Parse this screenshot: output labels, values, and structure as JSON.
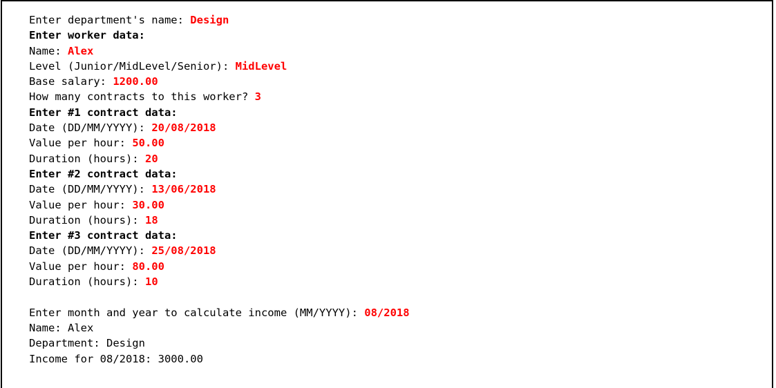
{
  "colors": {
    "input_text": "#ff0000",
    "output_text": "#000000",
    "background": "#ffffff",
    "border": "#000000"
  },
  "lines": {
    "dept_prompt": "Enter department's name: ",
    "dept_value": "Design",
    "worker_header": "Enter worker data:",
    "name_prompt": "Name: ",
    "name_value": "Alex",
    "level_prompt": "Level (Junior/MidLevel/Senior): ",
    "level_value": "MidLevel",
    "salary_prompt": "Base salary: ",
    "salary_value": "1200.00",
    "contracts_prompt": "How many contracts to this worker? ",
    "contracts_value": "3",
    "contracts": [
      {
        "header": "Enter #1 contract data:",
        "date_prompt": "Date (DD/MM/YYYY): ",
        "date_value": "20/08/2018",
        "value_prompt": "Value per hour: ",
        "value_value": "50.00",
        "duration_prompt": "Duration (hours): ",
        "duration_value": "20"
      },
      {
        "header": "Enter #2 contract data:",
        "date_prompt": "Date (DD/MM/YYYY): ",
        "date_value": "13/06/2018",
        "value_prompt": "Value per hour: ",
        "value_value": "30.00",
        "duration_prompt": "Duration (hours): ",
        "duration_value": "18"
      },
      {
        "header": "Enter #3 contract data:",
        "date_prompt": "Date (DD/MM/YYYY): ",
        "date_value": "25/08/2018",
        "value_prompt": "Value per hour: ",
        "value_value": "80.00",
        "duration_prompt": "Duration (hours): ",
        "duration_value": "10"
      }
    ],
    "month_prompt": "Enter month and year to calculate income (MM/YYYY): ",
    "month_value": "08/2018",
    "result_name": "Name: Alex",
    "result_department": "Department: Design",
    "result_income": "Income for 08/2018: 3000.00"
  }
}
